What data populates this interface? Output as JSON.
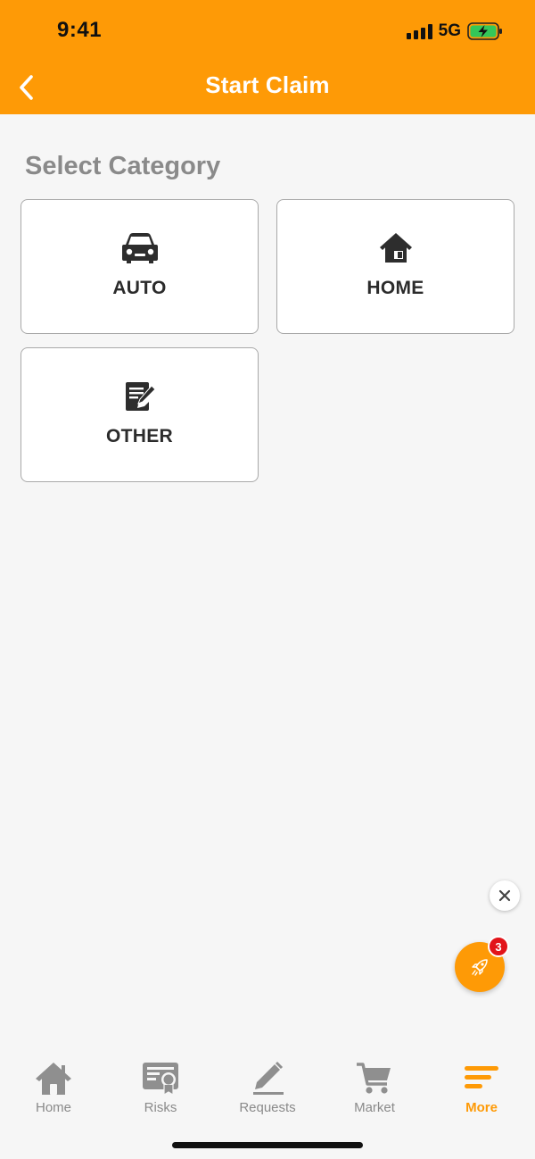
{
  "status_bar": {
    "time": "9:41",
    "network": "5G"
  },
  "nav": {
    "title": "Start Claim",
    "back_icon": "chevron-left-icon"
  },
  "section_title": "Select Category",
  "categories": [
    {
      "label": "AUTO",
      "icon": "car-icon"
    },
    {
      "label": "HOME",
      "icon": "house-icon"
    },
    {
      "label": "OTHER",
      "icon": "document-edit-icon"
    }
  ],
  "fab": {
    "badge_count": "3",
    "icon": "rocket-icon",
    "close_icon": "close-icon"
  },
  "tabbar": {
    "items": [
      {
        "label": "Home",
        "icon": "home-icon"
      },
      {
        "label": "Risks",
        "icon": "certificate-icon"
      },
      {
        "label": "Requests",
        "icon": "pencil-icon"
      },
      {
        "label": "Market",
        "icon": "cart-icon"
      },
      {
        "label": "More",
        "icon": "menu-icon",
        "active": true
      }
    ]
  },
  "colors": {
    "accent": "#fe9a06",
    "background": "#f6f6f6",
    "tab_inactive": "#8a8a8a",
    "badge": "#e2141a"
  }
}
